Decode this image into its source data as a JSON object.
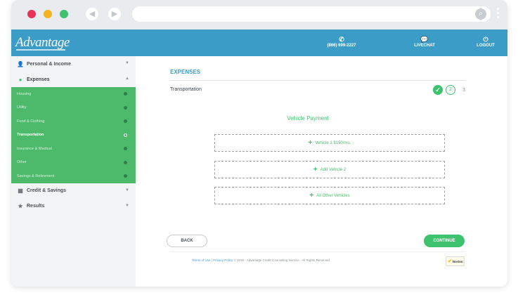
{
  "header": {
    "logo": "Advantage",
    "phone": "(866) 699-2227",
    "chat": "LIVECHAT",
    "logout": "LOGOUT"
  },
  "sidebar": {
    "groups": [
      {
        "label": "Personal & Income"
      },
      {
        "label": "Expenses"
      },
      {
        "label": "Credit & Savings"
      },
      {
        "label": "Results"
      }
    ],
    "expense_items": [
      {
        "label": "Housing"
      },
      {
        "label": "Utility"
      },
      {
        "label": "Food & Clothing"
      },
      {
        "label": "Transportation"
      },
      {
        "label": "Insurance & Medical"
      },
      {
        "label": "Other"
      },
      {
        "label": "Savings & Retirement"
      }
    ]
  },
  "main": {
    "title": "EXPENSES",
    "subtitle": "Transportation",
    "steps": {
      "current": "2",
      "next": "3"
    },
    "section_title": "Vehicle Payment",
    "choices": [
      {
        "label": "Vehicle 1 $150/mo."
      },
      {
        "label": "Add Vehicle 2"
      },
      {
        "label": "All Other Vehicles"
      }
    ],
    "back_label": "BACK",
    "continue_label": "CONTINUE",
    "footer_terms": "Terms of Use",
    "footer_privacy": "Privacy Policy",
    "footer_copy": "© 2018 - Advantage Credit Counseling Service - All Rights Reserved",
    "norton": "Norton"
  },
  "colors": {
    "header": "#3b9dc7",
    "accent_green": "#3ec26d",
    "sidebar_sub": "#4cba6a"
  }
}
